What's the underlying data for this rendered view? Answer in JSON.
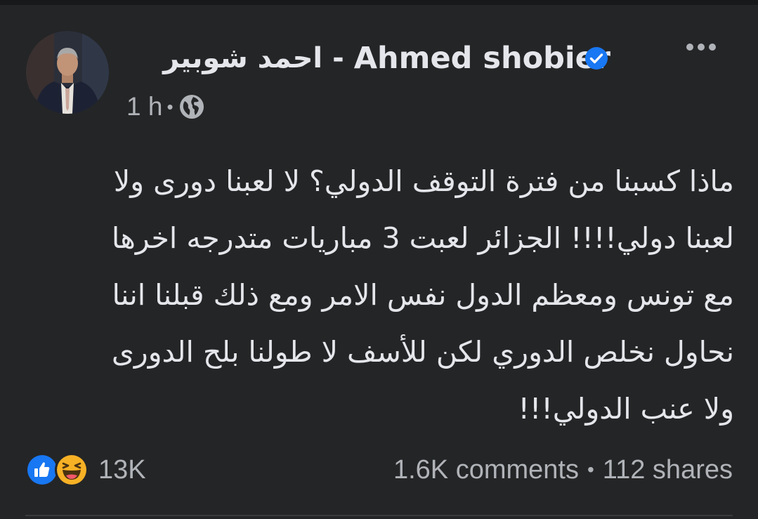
{
  "author": {
    "name_ar": "احمد شوبير",
    "separator": "-",
    "name_en": "Ahmed shobier",
    "verified_icon": "verified-badge-icon",
    "verified_color": "#1877f2"
  },
  "meta": {
    "time": "1 h",
    "separator": "•",
    "audience_icon": "globe-icon"
  },
  "menu": {
    "icon": "more-options-icon"
  },
  "post": {
    "lines": [
      "ماذا كسبنا من فترة التوقف الدولي؟ لا لعبنا دورى ولا",
      "لعبنا دولي!!!! الجزائر لعبت 3 مباريات متدرجه اخرها",
      "مع تونس ومعظم الدول نفس الامر ومع ذلك قبلنا اننا",
      "نحاول نخلص الدوري لكن للأسف لا طولنا بلح الدورى",
      "ولا عنب الدولي!!!"
    ]
  },
  "reactions": {
    "icons": [
      "like-icon",
      "haha-icon"
    ],
    "count": "13K",
    "like_color": "#1877f2",
    "haha_color": "#f7b125"
  },
  "engagement": {
    "comments": "1.6K comments",
    "separator": "•",
    "shares": "112 shares"
  },
  "theme": {
    "background": "#242526",
    "text_primary": "#e4e6eb",
    "text_secondary": "#b0b3b8"
  }
}
